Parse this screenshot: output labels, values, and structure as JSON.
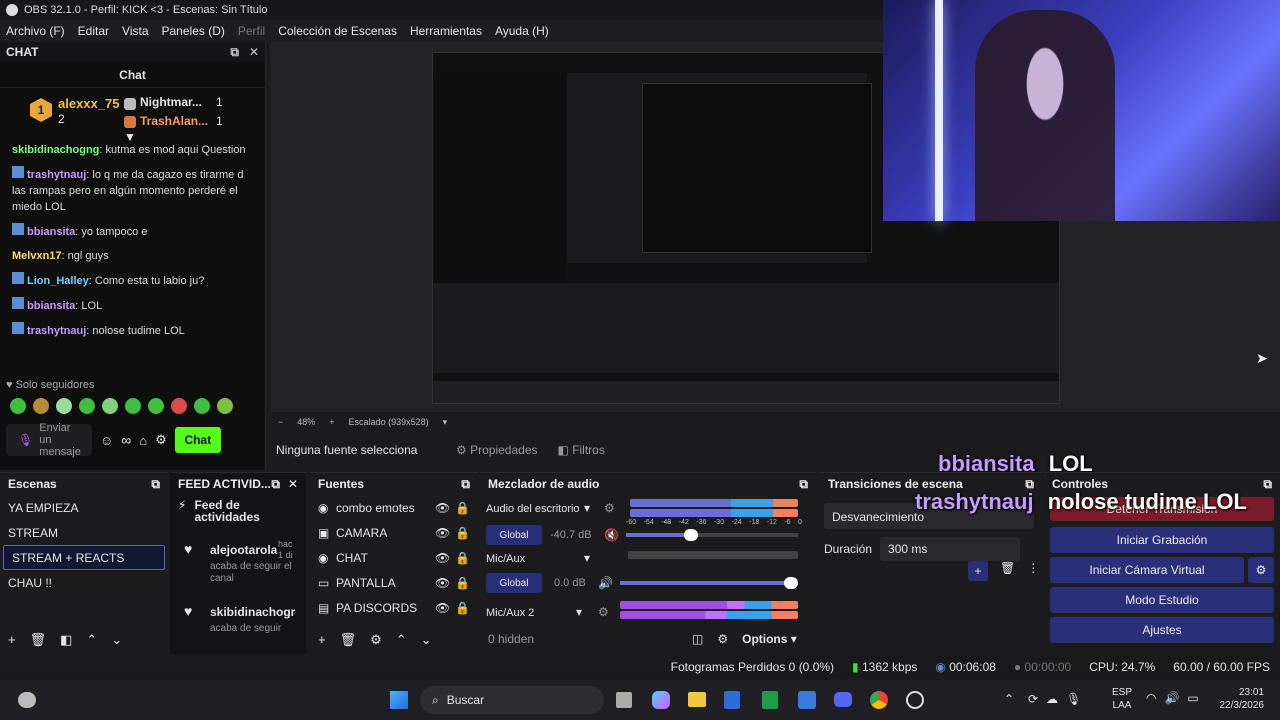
{
  "window": {
    "title": "OBS 32.1.0 - Perfil: KICK <3 - Escenas: Sin Título"
  },
  "menu": {
    "items": [
      "Archivo (F)",
      "Editar",
      "Vista",
      "Paneles (D)",
      "Perfil",
      "Colección de Escenas",
      "Herramientas",
      "Ayuda (H)"
    ]
  },
  "chat": {
    "dock_title": "CHAT",
    "title": "Chat",
    "top": {
      "first_user": "alexxx_75",
      "first_rank": "1",
      "first_count": "2",
      "second_user": "Nightmar...",
      "second_count": "1",
      "third_user": "TrashAlan...",
      "third_count": "1"
    },
    "messages": [
      {
        "user": "skibidinachogng",
        "color": "#7dff7d",
        "text": "kutma es mod aqui Question"
      },
      {
        "user": "trashytnauj",
        "color": "#c79bff",
        "text": "lo q me da cagazo es tirarme d las rampas pero en algún momento perderé el miedo LOL"
      },
      {
        "user": "bbiansita",
        "color": "#c79bff",
        "text": "yo tampoco e"
      },
      {
        "user": "Melvxn17",
        "color": "#ffe066",
        "text": "ngl guys"
      },
      {
        "user": "Lion_Halley",
        "color": "#6fd3ff",
        "text": "Como esta tu labio ju?"
      },
      {
        "user": "bbiansita",
        "color": "#c79bff",
        "text": "LOL"
      },
      {
        "user": "trashytnauj",
        "color": "#c79bff",
        "text": "nolose tudime LOL"
      }
    ],
    "followers_only": "Solo seguidores",
    "input_placeholder": "Enviar un mensaje",
    "send_label": "Chat"
  },
  "preview": {
    "zoom": "48%",
    "scaled": "Escalado (939x528)",
    "overlay_1_user": "bbiansita",
    "overlay_1_text": "LOL",
    "overlay_2_user": "trashytnauj",
    "overlay_2_text": "nolose tudime LOL"
  },
  "source_bar": {
    "no_source": "Ninguna fuente selecciona",
    "properties": "Propiedades",
    "filters": "Filtros"
  },
  "scenes": {
    "title": "Escenas",
    "items": [
      "YA EMPIEZA",
      "STREAM",
      "STREAM + REACTS",
      "CHAU !!"
    ],
    "selected": "STREAM + REACTS"
  },
  "feed": {
    "title": "FEED ACTIVID...",
    "header": "Feed de actividades",
    "entries": [
      {
        "user": "alejootarola",
        "time": "hac 1 di",
        "text": "acaba de seguir el canal"
      },
      {
        "user": "skibidinachogr",
        "time": "",
        "text": "acaba de seguir"
      }
    ]
  },
  "sources": {
    "title": "Fuentes",
    "items": [
      "combo emotes",
      "CAMARA",
      "CHAT",
      "PANTALLA",
      "PA DISCORDS"
    ]
  },
  "mixer": {
    "title": "Mezclador de audio",
    "desktop_label": "Audio del escritorio",
    "global_label": "Global",
    "desktop_db": "-40.7 dB",
    "mic_label": "Mic/Aux",
    "mic_db": "0.0 dB",
    "mic2_label": "Mic/Aux 2",
    "scale": [
      "-60",
      "-54",
      "-48",
      "-42",
      "-36",
      "-30",
      "-24",
      "-18",
      "-12",
      "-6",
      "0"
    ],
    "hidden": "0 hidden",
    "options": "Options"
  },
  "transitions": {
    "title": "Transiciones de escena",
    "type": "Desvanecimiento",
    "duration_label": "Duración",
    "duration_value": "300 ms"
  },
  "controls": {
    "title": "Controles",
    "stop_stream": "Detener Transmisión",
    "start_rec": "Iniciar Grabación",
    "start_vcam": "Iniciar Cámara Virtual",
    "studio": "Modo Estudio",
    "settings": "Ajustes"
  },
  "status": {
    "dropped": "Fotogramas Perdidos 0 (0.0%)",
    "bitrate": "1362 kbps",
    "stream_time": "00:06:08",
    "rec_time": "00:00:00",
    "cpu": "CPU: 24.7%",
    "fps": "60.00 / 60.00 FPS"
  },
  "taskbar": {
    "search": "Buscar",
    "lang": "ESP",
    "region": "LAA",
    "time": "23:01",
    "date": "22/3/2026"
  },
  "colors": {
    "accent": "#53fc18",
    "selected_bg": "#2a2f7a",
    "overlay_user": "#c79bff"
  }
}
